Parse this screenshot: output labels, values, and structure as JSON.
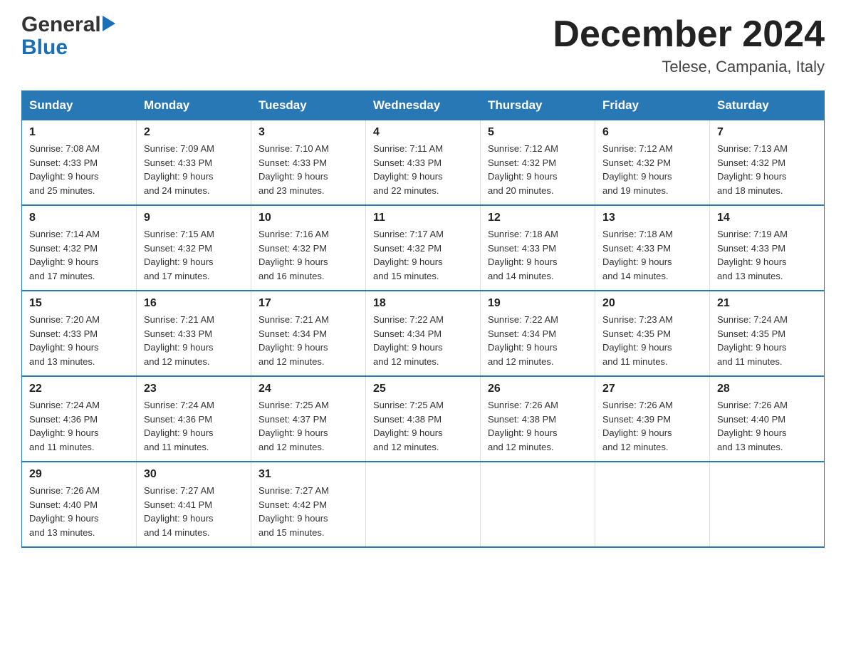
{
  "header": {
    "logo_general": "General",
    "logo_blue": "Blue",
    "month_title": "December 2024",
    "location": "Telese, Campania, Italy"
  },
  "days_of_week": [
    "Sunday",
    "Monday",
    "Tuesday",
    "Wednesday",
    "Thursday",
    "Friday",
    "Saturday"
  ],
  "weeks": [
    [
      {
        "day": "1",
        "sunrise": "7:08 AM",
        "sunset": "4:33 PM",
        "daylight": "9 hours and 25 minutes."
      },
      {
        "day": "2",
        "sunrise": "7:09 AM",
        "sunset": "4:33 PM",
        "daylight": "9 hours and 24 minutes."
      },
      {
        "day": "3",
        "sunrise": "7:10 AM",
        "sunset": "4:33 PM",
        "daylight": "9 hours and 23 minutes."
      },
      {
        "day": "4",
        "sunrise": "7:11 AM",
        "sunset": "4:33 PM",
        "daylight": "9 hours and 22 minutes."
      },
      {
        "day": "5",
        "sunrise": "7:12 AM",
        "sunset": "4:32 PM",
        "daylight": "9 hours and 20 minutes."
      },
      {
        "day": "6",
        "sunrise": "7:12 AM",
        "sunset": "4:32 PM",
        "daylight": "9 hours and 19 minutes."
      },
      {
        "day": "7",
        "sunrise": "7:13 AM",
        "sunset": "4:32 PM",
        "daylight": "9 hours and 18 minutes."
      }
    ],
    [
      {
        "day": "8",
        "sunrise": "7:14 AM",
        "sunset": "4:32 PM",
        "daylight": "9 hours and 17 minutes."
      },
      {
        "day": "9",
        "sunrise": "7:15 AM",
        "sunset": "4:32 PM",
        "daylight": "9 hours and 17 minutes."
      },
      {
        "day": "10",
        "sunrise": "7:16 AM",
        "sunset": "4:32 PM",
        "daylight": "9 hours and 16 minutes."
      },
      {
        "day": "11",
        "sunrise": "7:17 AM",
        "sunset": "4:32 PM",
        "daylight": "9 hours and 15 minutes."
      },
      {
        "day": "12",
        "sunrise": "7:18 AM",
        "sunset": "4:33 PM",
        "daylight": "9 hours and 14 minutes."
      },
      {
        "day": "13",
        "sunrise": "7:18 AM",
        "sunset": "4:33 PM",
        "daylight": "9 hours and 14 minutes."
      },
      {
        "day": "14",
        "sunrise": "7:19 AM",
        "sunset": "4:33 PM",
        "daylight": "9 hours and 13 minutes."
      }
    ],
    [
      {
        "day": "15",
        "sunrise": "7:20 AM",
        "sunset": "4:33 PM",
        "daylight": "9 hours and 13 minutes."
      },
      {
        "day": "16",
        "sunrise": "7:21 AM",
        "sunset": "4:33 PM",
        "daylight": "9 hours and 12 minutes."
      },
      {
        "day": "17",
        "sunrise": "7:21 AM",
        "sunset": "4:34 PM",
        "daylight": "9 hours and 12 minutes."
      },
      {
        "day": "18",
        "sunrise": "7:22 AM",
        "sunset": "4:34 PM",
        "daylight": "9 hours and 12 minutes."
      },
      {
        "day": "19",
        "sunrise": "7:22 AM",
        "sunset": "4:34 PM",
        "daylight": "9 hours and 12 minutes."
      },
      {
        "day": "20",
        "sunrise": "7:23 AM",
        "sunset": "4:35 PM",
        "daylight": "9 hours and 11 minutes."
      },
      {
        "day": "21",
        "sunrise": "7:24 AM",
        "sunset": "4:35 PM",
        "daylight": "9 hours and 11 minutes."
      }
    ],
    [
      {
        "day": "22",
        "sunrise": "7:24 AM",
        "sunset": "4:36 PM",
        "daylight": "9 hours and 11 minutes."
      },
      {
        "day": "23",
        "sunrise": "7:24 AM",
        "sunset": "4:36 PM",
        "daylight": "9 hours and 11 minutes."
      },
      {
        "day": "24",
        "sunrise": "7:25 AM",
        "sunset": "4:37 PM",
        "daylight": "9 hours and 12 minutes."
      },
      {
        "day": "25",
        "sunrise": "7:25 AM",
        "sunset": "4:38 PM",
        "daylight": "9 hours and 12 minutes."
      },
      {
        "day": "26",
        "sunrise": "7:26 AM",
        "sunset": "4:38 PM",
        "daylight": "9 hours and 12 minutes."
      },
      {
        "day": "27",
        "sunrise": "7:26 AM",
        "sunset": "4:39 PM",
        "daylight": "9 hours and 12 minutes."
      },
      {
        "day": "28",
        "sunrise": "7:26 AM",
        "sunset": "4:40 PM",
        "daylight": "9 hours and 13 minutes."
      }
    ],
    [
      {
        "day": "29",
        "sunrise": "7:26 AM",
        "sunset": "4:40 PM",
        "daylight": "9 hours and 13 minutes."
      },
      {
        "day": "30",
        "sunrise": "7:27 AM",
        "sunset": "4:41 PM",
        "daylight": "9 hours and 14 minutes."
      },
      {
        "day": "31",
        "sunrise": "7:27 AM",
        "sunset": "4:42 PM",
        "daylight": "9 hours and 15 minutes."
      },
      null,
      null,
      null,
      null
    ]
  ],
  "labels": {
    "sunrise": "Sunrise:",
    "sunset": "Sunset:",
    "daylight": "Daylight:"
  }
}
